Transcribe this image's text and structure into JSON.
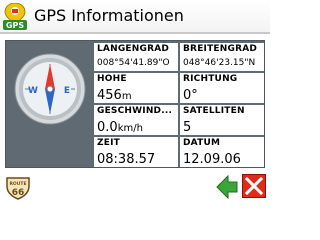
{
  "header": {
    "title": "GPS Informationen",
    "app_icon": "gps-satellite-icon",
    "app_icon_text": "GPS"
  },
  "fields": {
    "longitude": {
      "label": "LÄNGENGRAD",
      "value": "008°54'41.89\"O"
    },
    "latitude": {
      "label": "BREITENGRAD",
      "value": "048°46'23.15\"N"
    },
    "altitude": {
      "label": "HÖHE",
      "value": "456",
      "unit": "m"
    },
    "heading": {
      "label": "RICHTUNG",
      "value": "0°"
    },
    "speed": {
      "label": "GESCHWIND...",
      "value": "0.0",
      "unit": "km/h"
    },
    "satellites": {
      "label": "SATELLITEN",
      "value": "5"
    },
    "time": {
      "label": "ZEIT",
      "value": "08:38.57"
    },
    "date": {
      "label": "DATUM",
      "value": "12.09.06"
    }
  },
  "compass": {
    "icon": "compass-icon",
    "west_letter": "W",
    "east_letter": "E"
  },
  "footer": {
    "route_icon": "route-66-icon",
    "route_text_top": "ROUTE",
    "route_text_number": "66",
    "back_icon": "back-arrow-icon",
    "close_icon": "close-icon"
  },
  "colors": {
    "panel_bg": "#606a72",
    "back_green": "#3aa63a",
    "close_red": "#e02a1a"
  }
}
